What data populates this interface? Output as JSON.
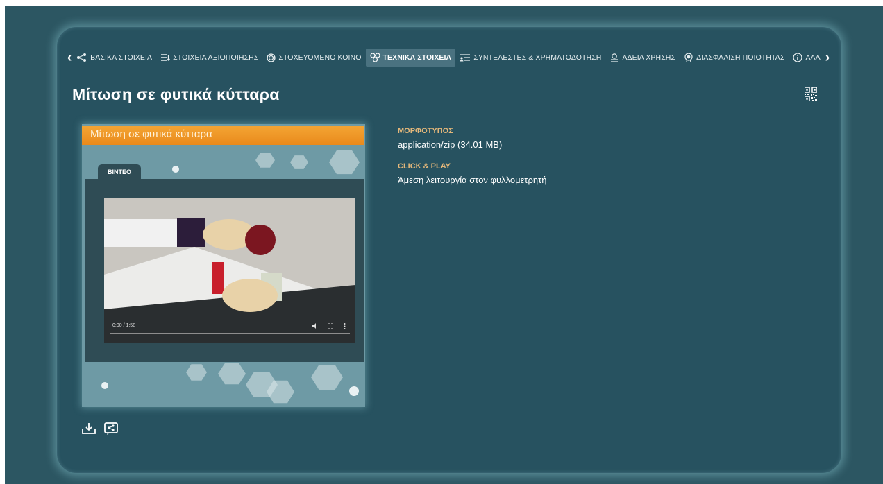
{
  "tabs": {
    "items": [
      {
        "label": "ΒΑΣΙΚΑ ΣΤΟΙΧΕΙΑ",
        "icon": "share-nodes-icon"
      },
      {
        "label": "ΣΤΟΙΧΕΙΑ ΑΞΙΟΠΟΙΗΣΗΣ",
        "icon": "list-sort-icon"
      },
      {
        "label": "ΣΤΟΧΕΥΟΜΕΝΟ ΚΟΙΝΟ",
        "icon": "target-icon"
      },
      {
        "label": "ΤΕΧΝΙΚΑ ΣΤΟΙΧΕΙΑ",
        "icon": "molecule-icon",
        "active": true
      },
      {
        "label": "ΣΥΝΤΕΛΕΣΤΕΣ & ΧΡΗΜΑΤΟΔΟΤΗΣΗ",
        "icon": "contributors-icon"
      },
      {
        "label": "ΑΔΕΙΑ ΧΡΗΣΗΣ",
        "icon": "license-icon"
      },
      {
        "label": "ΔΙΑΣΦΑΛΙΣΗ ΠΟΙΟΤΗΤΑΣ",
        "icon": "quality-badge-icon"
      },
      {
        "label": "ΑΛΛ",
        "icon": "info-icon"
      }
    ]
  },
  "page": {
    "title": "Μίτωση σε φυτικά κύτταρα"
  },
  "preview": {
    "header_title": "Μίτωση σε φυτικά κύτταρα",
    "tab_label": "ΒΙΝΤΕΟ",
    "video_time": "0:00 / 1:58"
  },
  "details": {
    "format_label": "ΜΟΡΦΟΤΥΠΟΣ",
    "format_value": "application/zip (34.01 MB)",
    "play_label": "CLICK & PLAY",
    "play_value": "Άμεση λειτουργία στον φυλλομετρητή"
  },
  "colors": {
    "background": "#2c5662",
    "panel": "#275260",
    "active_tab": "#4a7280",
    "label_accent": "#e3b77a",
    "preview_header": "#f4a534"
  }
}
